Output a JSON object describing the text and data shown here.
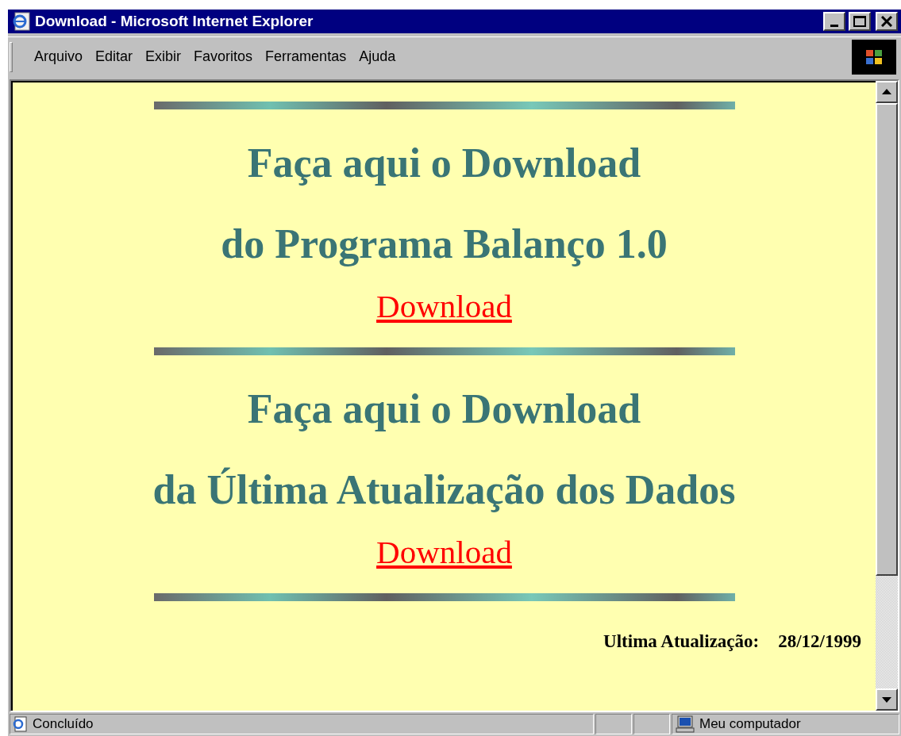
{
  "window": {
    "title": "Download - Microsoft Internet Explorer"
  },
  "menu": [
    "Arquivo",
    "Editar",
    "Exibir",
    "Favoritos",
    "Ferramentas",
    "Ajuda"
  ],
  "sections": [
    {
      "heading_lines": [
        "Faça aqui o Download",
        "do Programa Balanço 1.0"
      ],
      "link": "Download"
    },
    {
      "heading_lines": [
        "Faça aqui o Download",
        "da Última Atualização dos Dados"
      ],
      "link": "Download"
    }
  ],
  "footer": {
    "label": "Ultima Atualização:",
    "date": "28/12/1999"
  },
  "status_bar": {
    "text": "Concluído",
    "zone": "Meu computador"
  }
}
